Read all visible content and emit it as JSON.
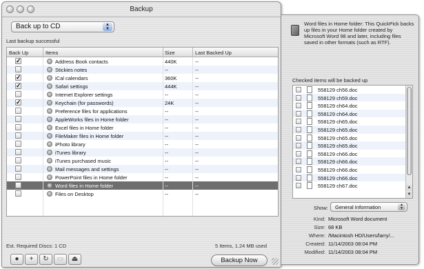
{
  "window": {
    "title": "Backup"
  },
  "controls": {
    "backup_target": "Back up to CD",
    "status": "Last backup successful"
  },
  "table": {
    "columns": [
      "Back Up",
      "Items",
      "Size",
      "Last Backed Up"
    ],
    "rows": [
      {
        "checked": true,
        "name": "Address Book contacts",
        "size": "440K",
        "last": "--"
      },
      {
        "checked": false,
        "name": "Stickies notes",
        "size": "--",
        "last": "--"
      },
      {
        "checked": true,
        "name": "iCal calendars",
        "size": "360K",
        "last": "--"
      },
      {
        "checked": true,
        "name": "Safari settings",
        "size": "444K",
        "last": "--"
      },
      {
        "checked": false,
        "name": "Internet Explorer settings",
        "size": "--",
        "last": "--"
      },
      {
        "checked": true,
        "name": "Keychain (for passwords)",
        "size": "24K",
        "last": "--"
      },
      {
        "checked": false,
        "name": "Preference files for applications",
        "size": "--",
        "last": "--"
      },
      {
        "checked": false,
        "name": "AppleWorks files in Home folder",
        "size": "--",
        "last": "--"
      },
      {
        "checked": false,
        "name": "Excel files in Home folder",
        "size": "--",
        "last": "--"
      },
      {
        "checked": false,
        "name": "FileMaker files in Home folder",
        "size": "--",
        "last": "--"
      },
      {
        "checked": false,
        "name": "iPhoto library",
        "size": "--",
        "last": "--"
      },
      {
        "checked": false,
        "name": "iTunes library",
        "size": "--",
        "last": "--"
      },
      {
        "checked": false,
        "name": "iTunes purchased music",
        "size": "--",
        "last": "--"
      },
      {
        "checked": false,
        "name": "Mail messages and settings",
        "size": "--",
        "last": "--"
      },
      {
        "checked": false,
        "name": "PowerPoint files in Home folder",
        "size": "--",
        "last": "--"
      },
      {
        "checked": false,
        "name": "Word files in Home folder",
        "size": "--",
        "last": "--",
        "selected": true
      },
      {
        "checked": false,
        "name": "Files on Desktop",
        "size": "--",
        "last": "--"
      }
    ]
  },
  "footer": {
    "required_discs": "Est. Required Discs: 1 CD",
    "usage": "5 Items, 1.24 MB used",
    "backup_button": "Backup Now",
    "toolbar": [
      "info",
      "add",
      "refresh",
      "disabled",
      "eject"
    ]
  },
  "drawer": {
    "description": "Word files in Home folder:  This QuickPick backs up files in your Home folder created by Microsoft Word 98 and later, including files saved in other formats (such as RTF).",
    "checked_label": "Checked items will be backed up",
    "files": [
      "558129 ch56.doc",
      "558129 ch59.doc",
      "558129 ch64.doc",
      "558129 ch64.doc",
      "558129 ch65.doc",
      "558129 ch65.doc",
      "558129 ch65.doc",
      "558129 ch65.doc",
      "558129 ch66.doc",
      "558129 ch66.doc",
      "558129 ch66.doc",
      "558129 ch66.doc",
      "558129 ch67.doc"
    ],
    "show_label": "Show:",
    "show_value": "General Information",
    "info": [
      {
        "key": "Kind:",
        "value": "Microsoft Word document"
      },
      {
        "key": "Size:",
        "value": "68 KB"
      },
      {
        "key": "Where:",
        "value": "/Macintosh HD/Users/larry/..."
      },
      {
        "key": "Created:",
        "value": "11/14/2003 08:04 PM"
      },
      {
        "key": "Modified:",
        "value": "11/14/2003 08:04 PM"
      }
    ]
  }
}
